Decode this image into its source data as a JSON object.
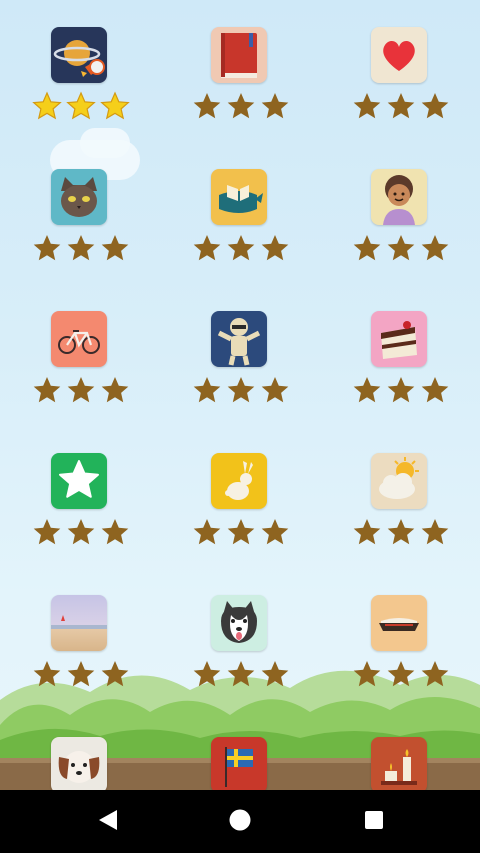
{
  "levels": [
    {
      "icon": "saturn-rocket-icon",
      "earned": 3
    },
    {
      "icon": "book-icon",
      "earned": 0
    },
    {
      "icon": "heart-icon",
      "earned": 0
    },
    {
      "icon": "cat-icon",
      "earned": 0
    },
    {
      "icon": "whale-book-icon",
      "earned": 0
    },
    {
      "icon": "grandmother-icon",
      "earned": 0
    },
    {
      "icon": "bicycle-icon",
      "earned": 0
    },
    {
      "icon": "mummy-icon",
      "earned": 0
    },
    {
      "icon": "cake-icon",
      "earned": 0
    },
    {
      "icon": "star-icon",
      "earned": 0
    },
    {
      "icon": "rabbit-icon",
      "earned": 0
    },
    {
      "icon": "sun-cloud-icon",
      "earned": 0
    },
    {
      "icon": "beach-icon",
      "earned": 0
    },
    {
      "icon": "husky-dog-icon",
      "earned": 0
    },
    {
      "icon": "pie-icon",
      "earned": 0
    },
    {
      "icon": "puppy-icon",
      "earned": 0
    },
    {
      "icon": "swedish-flag-icon",
      "earned": 0
    },
    {
      "icon": "candle-icon",
      "earned": 0
    }
  ],
  "colors": {
    "star_gold": "#f5cf1a",
    "star_brown": "#8e6420",
    "navbar": "#000000"
  },
  "navbar": {
    "back": "back-icon",
    "home": "home-icon",
    "recents": "recents-icon"
  }
}
